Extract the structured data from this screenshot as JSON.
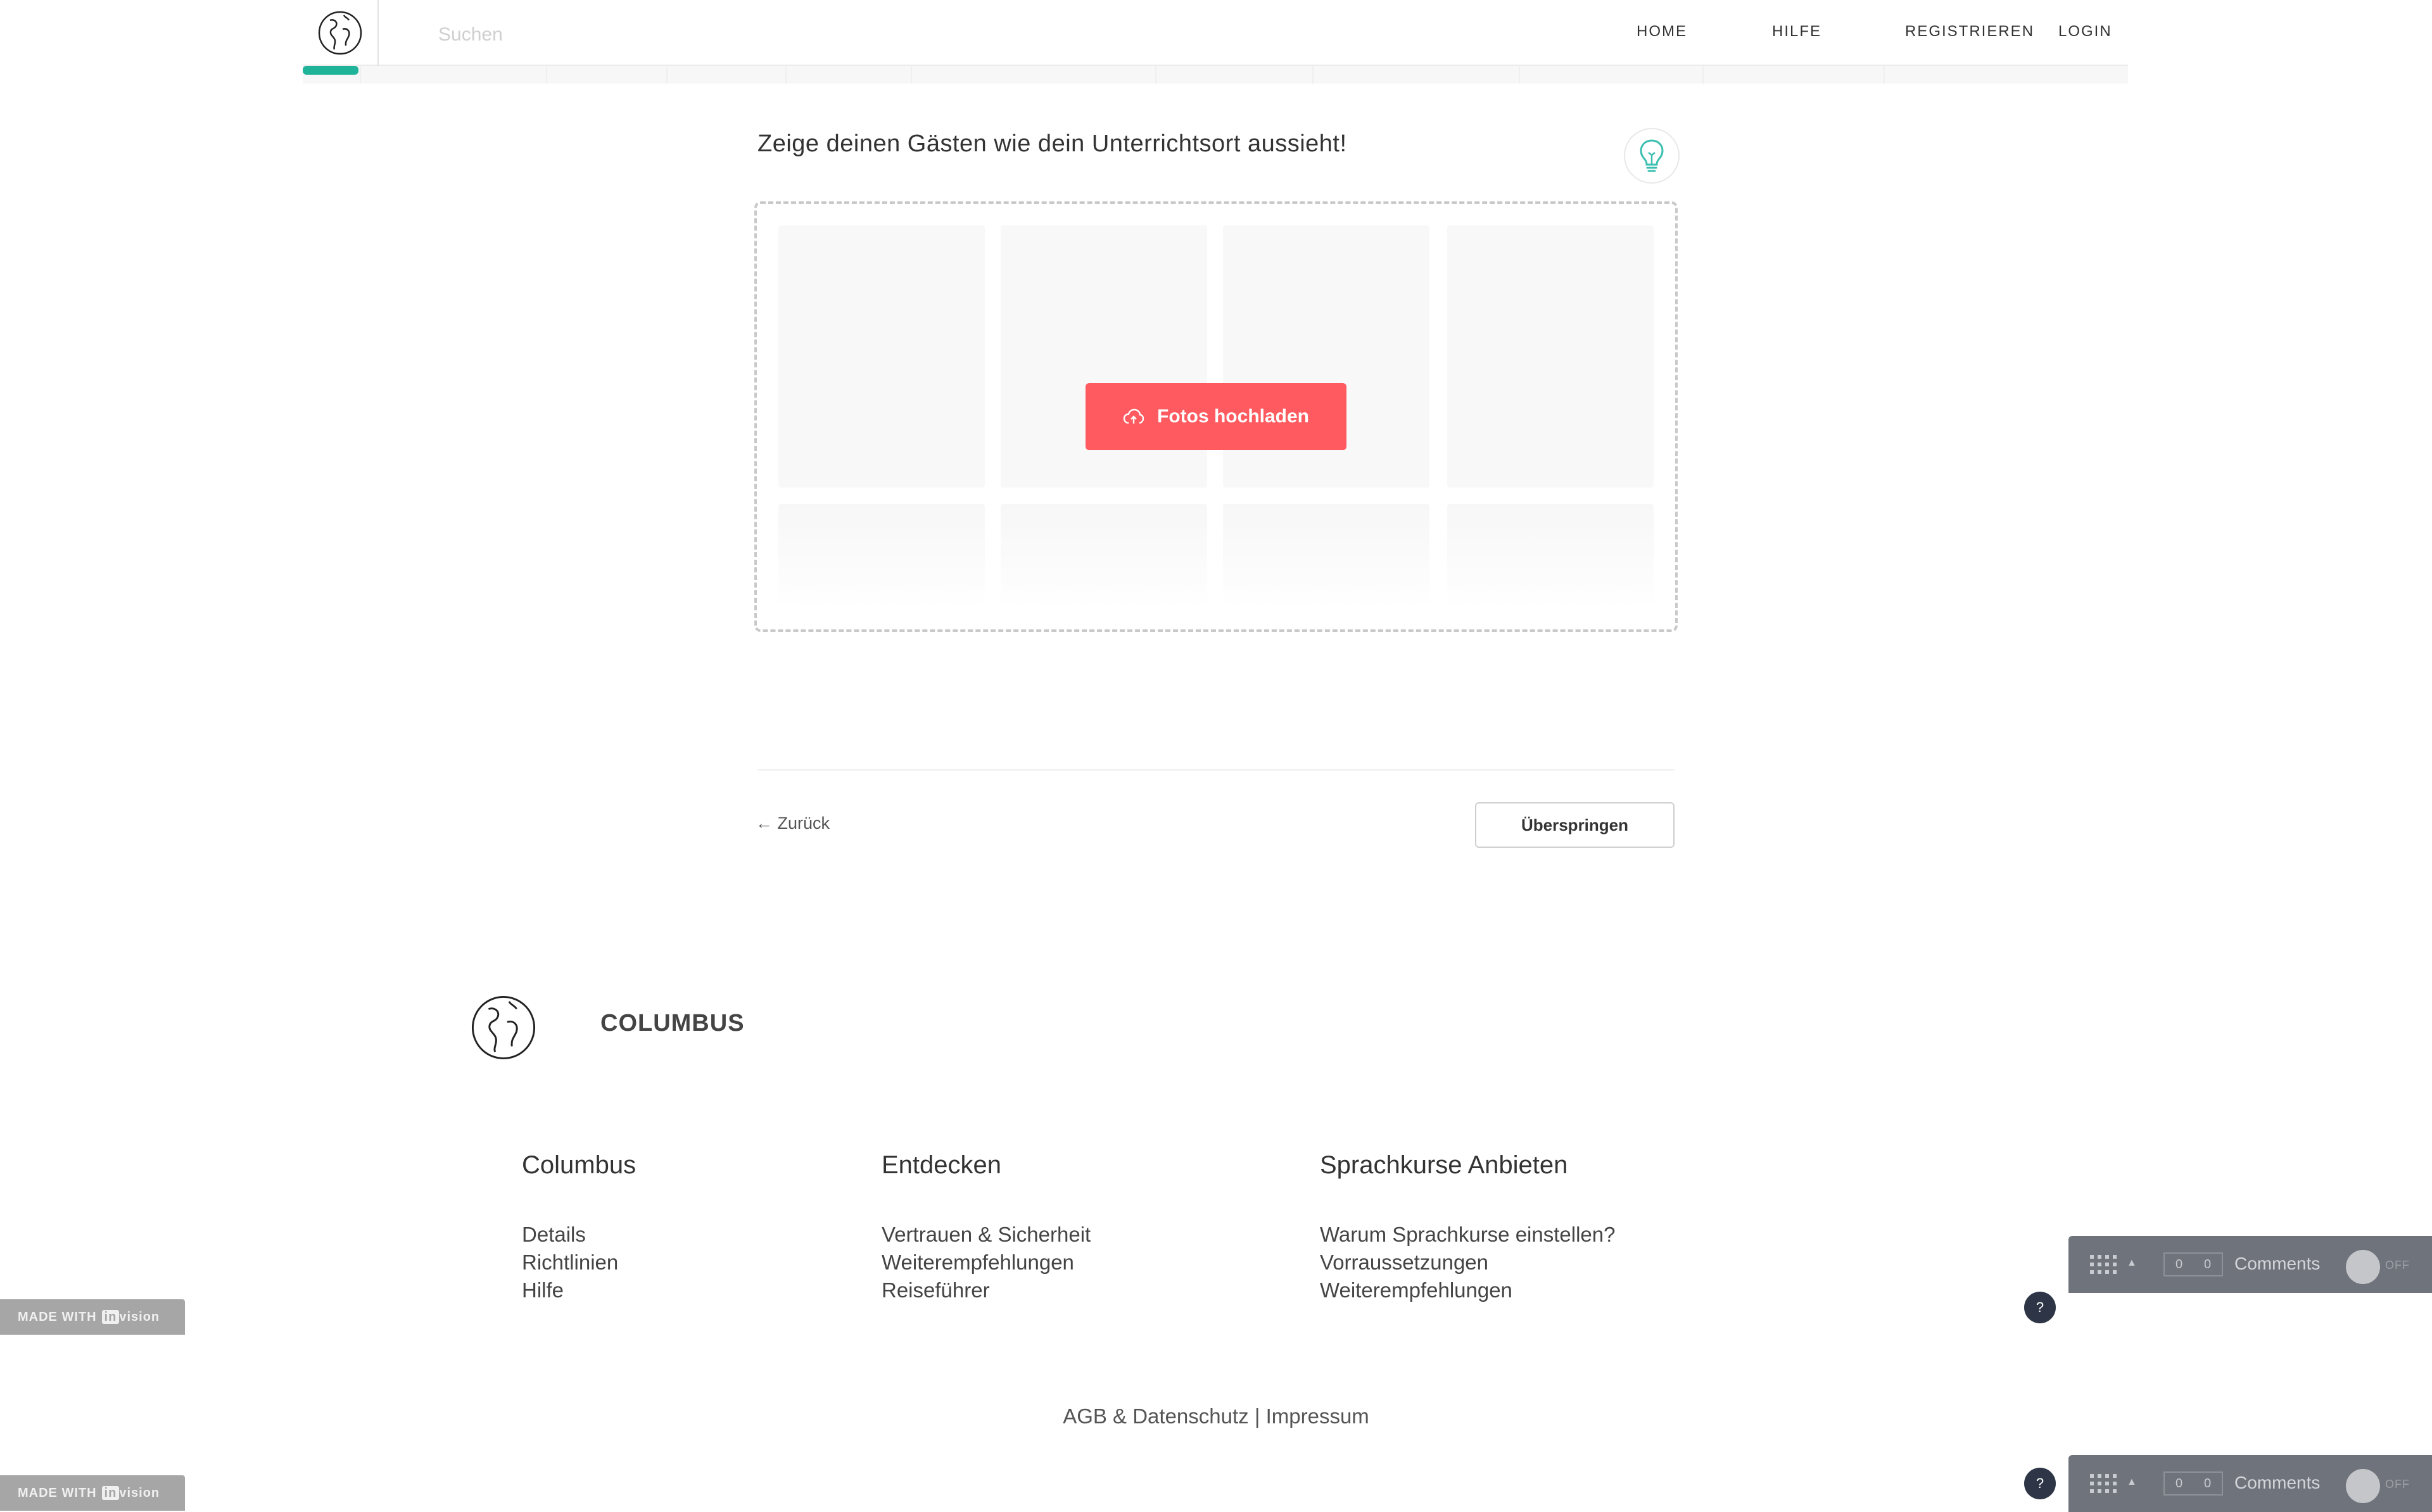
{
  "header": {
    "search_placeholder": "Suchen",
    "nav": {
      "home": "HOME",
      "help": "HILFE",
      "register": "REGISTRIEREN",
      "login": "LOGIN"
    },
    "active_accent": "#1fb39a"
  },
  "main": {
    "heading": "Zeige deinen Gästen wie dein Unterrichtsort aussieht!",
    "upload_button_label": "Fotos hochladen",
    "upload_color": "#fe5a5f",
    "back_label": "← Zurück",
    "skip_label": "Überspringen"
  },
  "footer": {
    "brand": "COLUMBUS",
    "columns": [
      {
        "title": "Columbus",
        "links": [
          "Details",
          "Richtlinien",
          "Hilfe"
        ]
      },
      {
        "title": "Entdecken",
        "links": [
          "Vertrauen & Sicherheit",
          "Weiterempfehlungen",
          "Reiseführer"
        ]
      },
      {
        "title": "Sprachkurse Anbieten",
        "links": [
          "Warum Sprachkurse einstellen?",
          "Vorraussetzungen",
          "Weiterempfehlungen"
        ]
      }
    ],
    "legal_agb": "AGB & Datenschutz",
    "legal_separator": "|",
    "legal_imprint": "Impressum"
  },
  "invision": {
    "made_with": "MADE WITH",
    "brand_in": "in",
    "brand_vision": "vision",
    "help": "?",
    "counter_left": "0",
    "counter_right": "0",
    "comments_label": "Comments",
    "toggle_label": "OFF"
  }
}
